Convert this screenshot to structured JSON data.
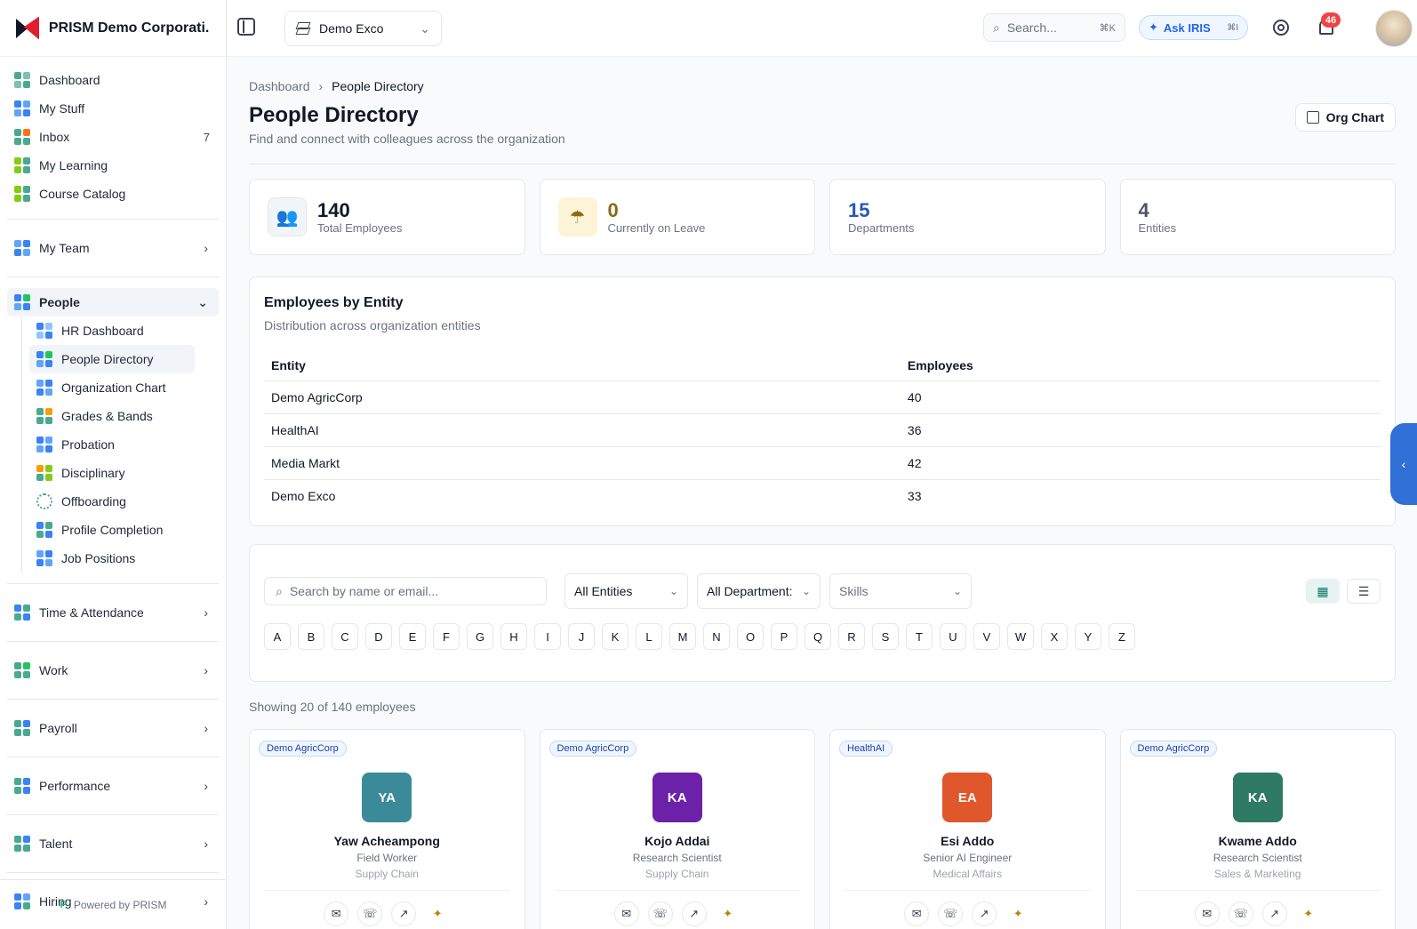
{
  "brand": {
    "name": "PRISM Demo Corporati..."
  },
  "topbar": {
    "entity": "Demo Exco",
    "search_placeholder": "Search...",
    "search_kbd": "⌘K",
    "ask_label": "Ask IRIS",
    "ask_kbd": "⌘I",
    "notifications": "46"
  },
  "sidebar": {
    "top": [
      {
        "label": "Dashboard"
      },
      {
        "label": "My Stuff"
      },
      {
        "label": "Inbox",
        "count": "7"
      },
      {
        "label": "My Learning"
      },
      {
        "label": "Course Catalog"
      }
    ],
    "my_team": "My Team",
    "people": "People",
    "people_items": [
      {
        "label": "HR Dashboard"
      },
      {
        "label": "People Directory"
      },
      {
        "label": "Organization Chart"
      },
      {
        "label": "Grades & Bands"
      },
      {
        "label": "Probation"
      },
      {
        "label": "Disciplinary"
      },
      {
        "label": "Offboarding"
      },
      {
        "label": "Profile Completion"
      },
      {
        "label": "Job Positions"
      }
    ],
    "groups": [
      {
        "label": "Time & Attendance"
      },
      {
        "label": "Work"
      },
      {
        "label": "Payroll"
      },
      {
        "label": "Performance"
      },
      {
        "label": "Talent"
      },
      {
        "label": "Hiring"
      }
    ],
    "powered": "Powered by PRISM"
  },
  "main": {
    "breadcrumb": [
      "Dashboard",
      "People Directory"
    ],
    "title": "People Directory",
    "subtitle": "Find and connect with colleagues across the organization",
    "org_chart_label": "Org Chart",
    "stats": [
      {
        "value": "140",
        "label": "Total Employees",
        "color": "#111827"
      },
      {
        "value": "0",
        "label": "Currently on Leave",
        "color": "#8a6a14"
      },
      {
        "value": "15",
        "label": "Departments",
        "color": "#2855b8"
      },
      {
        "value": "4",
        "label": "Entities",
        "color": "#4b5563"
      }
    ],
    "entity_card": {
      "title": "Employees by Entity",
      "desc": "Distribution across organization entities",
      "headers": [
        "Entity",
        "Employees"
      ],
      "rows": [
        [
          "Demo AgricCorp",
          "40"
        ],
        [
          "HealthAI",
          "36"
        ],
        [
          "Media Markt",
          "42"
        ],
        [
          "Demo Exco",
          "33"
        ]
      ]
    },
    "filters": {
      "search_placeholder": "Search by name or email...",
      "entities": "All Entities",
      "departments": "All Department:",
      "skills": "Skills",
      "letters": [
        "A",
        "B",
        "C",
        "D",
        "E",
        "F",
        "G",
        "H",
        "I",
        "J",
        "K",
        "L",
        "M",
        "N",
        "O",
        "P",
        "Q",
        "R",
        "S",
        "T",
        "U",
        "V",
        "W",
        "X",
        "Y",
        "Z"
      ]
    },
    "showing": "Showing 20 of 140 employees",
    "people": [
      {
        "tag": "Demo AgricCorp",
        "initials": "YA",
        "name": "Yaw Acheampong",
        "role": "Field Worker",
        "dept": "Supply Chain",
        "color": "#3a8a9a"
      },
      {
        "tag": "Demo AgricCorp",
        "initials": "KA",
        "name": "Kojo Addai",
        "role": "Research Scientist",
        "dept": "Supply Chain",
        "color": "#6b21a8"
      },
      {
        "tag": "HealthAI",
        "initials": "EA",
        "name": "Esi Addo",
        "role": "Senior AI Engineer",
        "dept": "Medical Affairs",
        "color": "#e0572b"
      },
      {
        "tag": "Demo AgricCorp",
        "initials": "KA",
        "name": "Kwame Addo",
        "role": "Research Scientist",
        "dept": "Sales & Marketing",
        "color": "#2f7a63"
      }
    ]
  }
}
